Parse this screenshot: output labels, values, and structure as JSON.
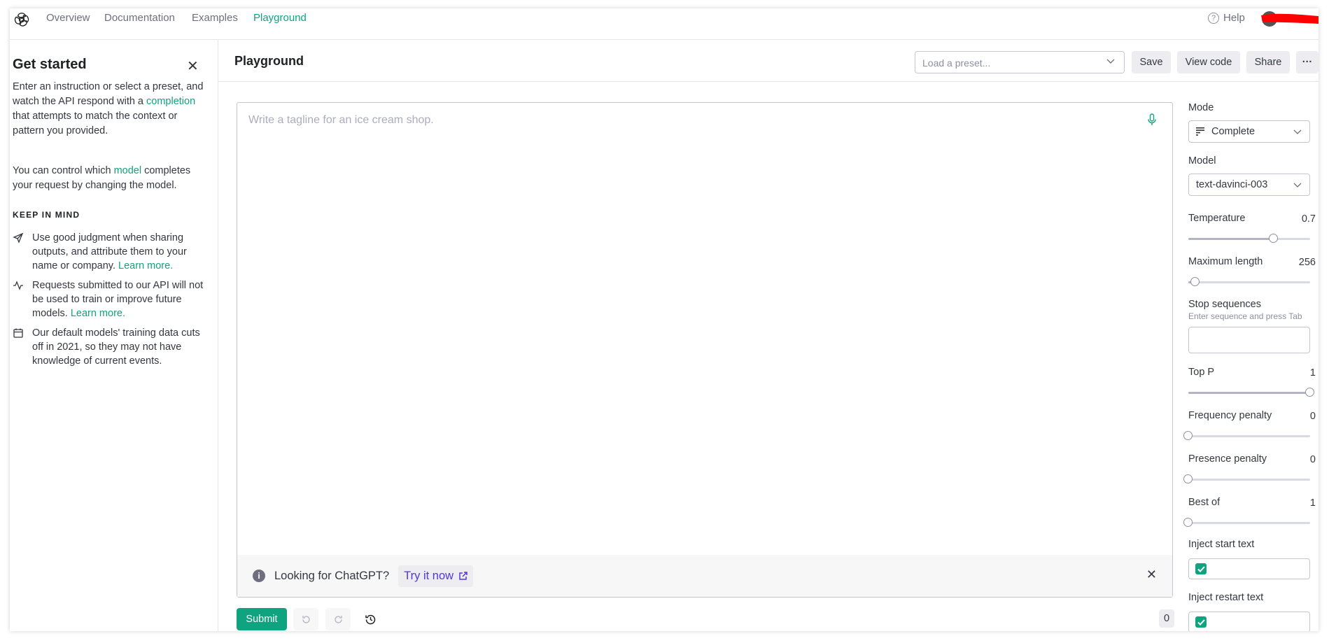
{
  "nav": {
    "items": [
      "Overview",
      "Documentation",
      "Examples",
      "Playground"
    ],
    "active": "Playground",
    "help_label": "Help"
  },
  "sidebar": {
    "title": "Get started",
    "intro_before": "Enter an instruction or select a preset, and watch the API respond with a ",
    "intro_link": "completion",
    "intro_after": " that attempts to match the context or pattern you provided.",
    "model_before": "You can control which ",
    "model_link": "model",
    "model_after": " completes your request by changing the model.",
    "keep_in_mind": "KEEP IN MIND",
    "tips": [
      {
        "icon": "send-icon",
        "text": "Use good judgment when sharing outputs, and attribute them to your name or company. ",
        "link": "Learn more."
      },
      {
        "icon": "activity-icon",
        "text": "Requests submitted to our API will not be used to train or improve future models. ",
        "link": "Learn more."
      },
      {
        "icon": "calendar-icon",
        "text": "Our default models' training data cuts off in 2021, so they may not have knowledge of current events.",
        "link": ""
      }
    ]
  },
  "header": {
    "title": "Playground",
    "preset_placeholder": "Load a preset...",
    "save": "Save",
    "view_code": "View code",
    "share": "Share",
    "more": "···"
  },
  "editor": {
    "placeholder": "Write a tagline for an ice cream shop.",
    "banner_text": "Looking for ChatGPT?",
    "banner_link": "Try it now"
  },
  "footer": {
    "submit": "Submit",
    "token_count": "0"
  },
  "settings": {
    "mode_label": "Mode",
    "mode_value": "Complete",
    "model_label": "Model",
    "model_value": "text-davinci-003",
    "temperature": {
      "label": "Temperature",
      "value": "0.7",
      "fraction": 0.7
    },
    "max_length": {
      "label": "Maximum length",
      "value": "256",
      "fraction": 0.06
    },
    "stop_label": "Stop sequences",
    "stop_hint": "Enter sequence and press Tab",
    "top_p": {
      "label": "Top P",
      "value": "1",
      "fraction": 1.0
    },
    "freq": {
      "label": "Frequency penalty",
      "value": "0",
      "fraction": 0.0
    },
    "presence": {
      "label": "Presence penalty",
      "value": "0",
      "fraction": 0.0
    },
    "best_of": {
      "label": "Best of",
      "value": "1",
      "fraction": 0.0
    },
    "inject_start": "Inject start text",
    "inject_restart": "Inject restart text"
  },
  "colors": {
    "accent": "#10a37f",
    "link_purple": "#5436da"
  }
}
